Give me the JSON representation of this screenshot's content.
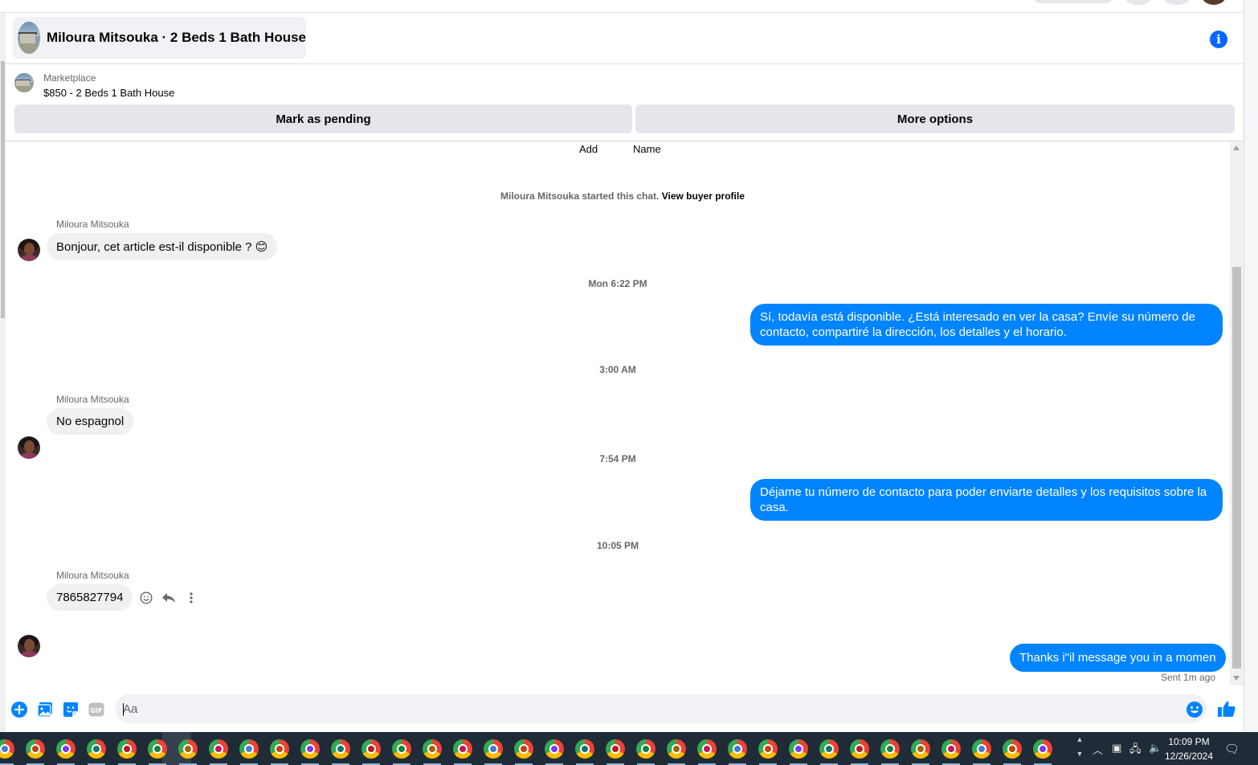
{
  "header": {
    "title": "Miloura Mitsouka · 2 Beds 1 Bath House"
  },
  "marketplace": {
    "label": "Marketplace",
    "price_title": "$850 - 2 Beds 1 Bath House",
    "mark_pending_label": "Mark as pending",
    "more_options_label": "More options"
  },
  "chat": {
    "add_label": "Add",
    "name_label": "Name",
    "started_text": "Miloura Mitsouka started this chat.",
    "view_buyer_profile": "View buyer profile",
    "messages": [
      {
        "sender": "Miloura Mitsouka",
        "text": "Bonjour, cet article est-il disponible ? 😊"
      },
      {
        "timestamp": "Mon 6:22 PM"
      },
      {
        "text": "Sí, todavía está disponible. ¿Está interesado en ver la casa? Envíe su número de contacto, compartiré la dirección, los detalles y el horario."
      },
      {
        "timestamp": "3:00 AM"
      },
      {
        "sender": "Miloura Mitsouka",
        "text": "No espagnol"
      },
      {
        "timestamp": "7:54 PM"
      },
      {
        "text": "Déjame tu número de contacto para poder enviarte detalles y los requisitos sobre la casa."
      },
      {
        "timestamp": "10:05 PM"
      },
      {
        "sender": "Miloura Mitsouka",
        "text": "7865827794"
      },
      {
        "text": "Thanks i\"il message you in a momen",
        "status": "Sent 1m ago"
      }
    ]
  },
  "composer": {
    "placeholder": "Aa"
  },
  "taskbar": {
    "time": "10:09 PM",
    "date": "12/26/2024"
  },
  "colors": {
    "accent": "#0084ff",
    "info": "#0866ff",
    "incoming_bubble": "#f0f0f0",
    "taskbar": "#1f2b36"
  }
}
